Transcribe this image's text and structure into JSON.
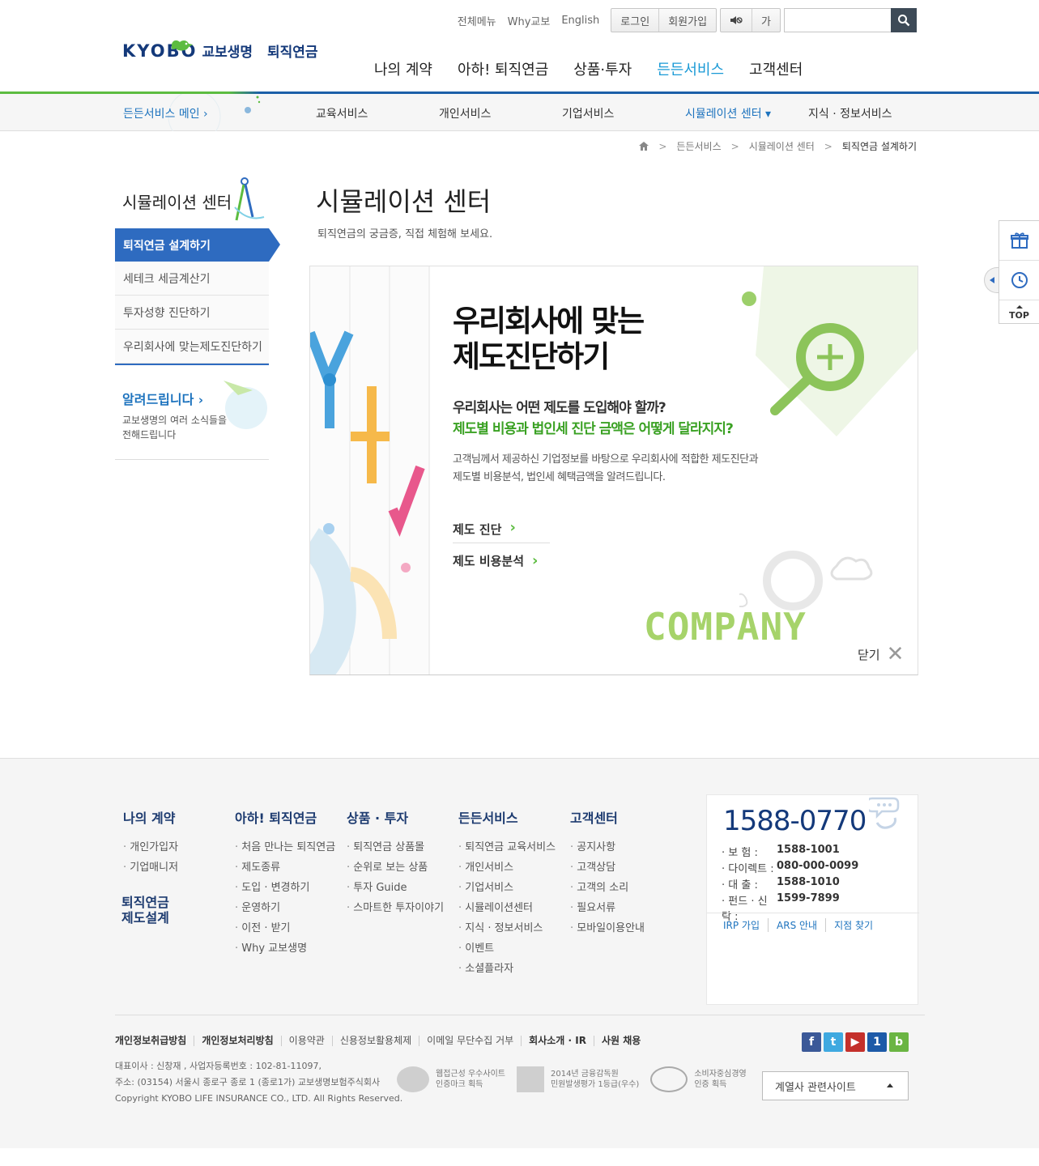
{
  "util": {
    "links": [
      "전체메뉴",
      "Why교보",
      "English"
    ],
    "login": "로그인",
    "join": "회원가입",
    "font_size": "가",
    "search_placeholder": ""
  },
  "header": {
    "logo_en": "KYOBO",
    "logo_ko": "교보생명",
    "service": "퇴직연금",
    "gnb": [
      "나의 계약",
      "아하! 퇴직연금",
      "상품·투자",
      "든든서비스",
      "고객센터"
    ],
    "gnb_active": "든든서비스"
  },
  "subnav": {
    "home": "든든서비스 메인 ›",
    "items": [
      "교육서비스",
      "개인서비스",
      "기업서비스",
      "시뮬레이션 센터 ▾",
      "지식 · 정보서비스"
    ]
  },
  "breadcrumb": [
    "든든서비스",
    "시뮬레이션 센터",
    "퇴직연금 설계하기"
  ],
  "lnb": {
    "title": "시뮬레이션 센터",
    "items": [
      "퇴직연금 설계하기",
      "세테크 세금계산기",
      "투자성향 진단하기",
      "우리회사에 맞는제도진단하기"
    ],
    "notice_title": "알려드립니다",
    "notice_desc": "교보생명의 여러 소식들을 전해드립니다"
  },
  "content": {
    "title": "시뮬레이션 센터",
    "desc": "퇴직연금의 궁금증, 직접 체험해 보세요.",
    "panel_title_1": "우리회사에 맞는",
    "panel_title_2": "제도진단하기",
    "q1": "우리회사는 어떤 제도를 도입해야 할까?",
    "q2": "제도별 비용과 법인세 진단 금액은 어떻게 달라지지?",
    "desc_1": "고객님께서 제공하신 기업정보를 바탕으로 우리회사에 적합한 제도진단과",
    "desc_2": "제도별 비용분석, 법인세 혜택금액을 알려드립니다.",
    "link_1": "제도 진단",
    "link_2": "제도 비용분석",
    "company": "COMPANY",
    "close": "닫기"
  },
  "quick": {
    "top": "TOP"
  },
  "footer": {
    "cols": [
      {
        "head": "나의 계약",
        "items": [
          "개인가입자",
          "기업매니저"
        ]
      },
      {
        "head": "아하! 퇴직연금",
        "items": [
          "처음 만나는 퇴직연금",
          "제도종류",
          "도입 · 변경하기",
          "운영하기",
          "이전 · 받기",
          "Why 교보생명"
        ]
      },
      {
        "head": "상품 · 투자",
        "items": [
          "퇴직연금 상품몰",
          "순위로 보는 상품",
          "투자 Guide",
          "스마트한 투자이야기"
        ]
      },
      {
        "head": "든든서비스",
        "items": [
          "퇴직연금 교육서비스",
          "개인서비스",
          "기업서비스",
          "시뮬레이션센터",
          "지식 · 정보서비스",
          "이벤트",
          "소셜플라자"
        ]
      },
      {
        "head": "고객센터",
        "items": [
          "공지사항",
          "고객상담",
          "고객의 소리",
          "필요서류",
          "모바일이용안내"
        ]
      }
    ],
    "extra_1": "퇴직연금",
    "extra_2": "제도설계",
    "call": {
      "number": "1588-0770",
      "rows": [
        {
          "label": "보     험 :",
          "value": "1588-1001"
        },
        {
          "label": "다이렉트 :",
          "value": "080-000-0099"
        },
        {
          "label": "대     출 :",
          "value": "1588-1010"
        },
        {
          "label": "펀드 · 신탁 :",
          "value": "1599-7899"
        }
      ],
      "links": [
        "IRP 가입",
        "ARS 안내",
        "지점 찾기"
      ]
    },
    "policy": [
      "개인정보취급방침",
      "개인정보처리방침",
      "이용약관",
      "신용정보활용체제",
      "이메일 무단수집 거부",
      "회사소개 · IR",
      "사원 채용"
    ],
    "addr_1": "대표이사 : 신창재 , 사업자등록번호 : 102-81-11097,",
    "addr_2": "주소: (03154) 서울시 종로구 종로 1 (종로1가) 교보생명보험주식회사",
    "copyright": "Copyright KYOBO LIFE INSURANCE CO., LTD. All Rights Reserved.",
    "marks": [
      {
        "t1": "웹접근성 우수사이트",
        "t2": "인증마크 획득"
      },
      {
        "t1": "2014년 금융감독원",
        "t2": "민원발생평가 1등급(우수)"
      },
      {
        "t1": "소비자중심경영",
        "t2": "인증 획득"
      }
    ],
    "family": "계열사 관련사이트"
  }
}
